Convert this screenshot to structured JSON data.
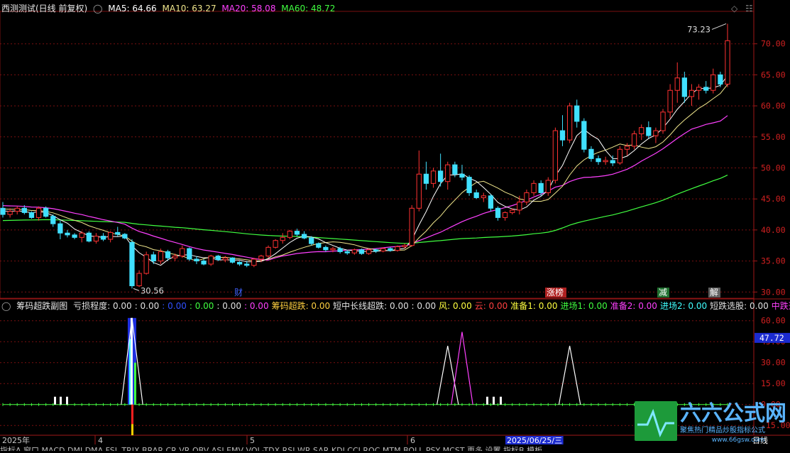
{
  "header": {
    "title": "西测测试(日线 前复权)",
    "ma": [
      {
        "label": "MA5: 64.66",
        "color": "#ffffff"
      },
      {
        "label": "MA10: 63.27",
        "color": "#f0e68c"
      },
      {
        "label": "MA20: 58.08",
        "color": "#ff40ff"
      },
      {
        "label": "MA60: 48.72",
        "color": "#40ff40"
      }
    ]
  },
  "sub_header": {
    "title": "筹码超跌副图",
    "items": [
      {
        "label": "亏损程度: 0.00",
        "color": "#e0e0e0"
      },
      {
        "label": ": 0.00",
        "color": "#e0e0e0"
      },
      {
        "label": ": 0.00",
        "color": "#3050ff"
      },
      {
        "label": ": 0.00",
        "color": "#40ff40"
      },
      {
        "label": ": 0.00",
        "color": "#e0e0e0"
      },
      {
        "label": ": 0.00",
        "color": "#ff40ff"
      },
      {
        "label": "筹码超跌: 0.00",
        "color": "#ffd040"
      },
      {
        "label": "短中长线超跌: 0.00 : 0.00",
        "color": "#e0e0e0"
      },
      {
        "label": "风: 0.00",
        "color": "#ffff40"
      },
      {
        "label": "云: 0.00",
        "color": "#ff4040"
      },
      {
        "label": "准备1: 0.00",
        "color": "#ffff40"
      },
      {
        "label": "进场1: 0.00",
        "color": "#40ff40"
      },
      {
        "label": "准备2: 0.00",
        "color": "#ff40ff"
      },
      {
        "label": "进场2: 0.00",
        "color": "#40ffff"
      },
      {
        "label": "短跌选股: 0.00",
        "color": "#e0e0e0"
      },
      {
        "label": "中跌选股",
        "color": "#ff40ff"
      }
    ]
  },
  "colors": {
    "up": "#ff3232",
    "down": "#40e0ff",
    "ma5": "#ffffff",
    "ma10": "#f0e68c",
    "ma20": "#ff40ff",
    "ma60": "#40ff40",
    "grid": "#7a1010"
  },
  "chart_data": [
    {
      "type": "candlestick",
      "y_ticks": [
        "70.00",
        "65.00",
        "60.00",
        "55.00",
        "50.00",
        "45.00",
        "40.00",
        "35.00",
        "30.00"
      ],
      "ylim": [
        29,
        75
      ],
      "annotations": {
        "high": "73.23",
        "low": "30.56"
      },
      "event_tags": [
        {
          "text": "财",
          "color": "#4060ff",
          "bg": "#000"
        },
        {
          "text": "涨榜",
          "color": "#fff",
          "bg": "#b02020"
        },
        {
          "text": "减",
          "color": "#fff",
          "bg": "#207030"
        },
        {
          "text": "解",
          "color": "#fff",
          "bg": "#606060"
        }
      ],
      "candles": [
        [
          43.5,
          44.5,
          42.0,
          42.5
        ],
        [
          42.5,
          43.5,
          42.0,
          43.0
        ],
        [
          43.0,
          43.8,
          42.5,
          43.5
        ],
        [
          43.5,
          44.0,
          42.5,
          42.8
        ],
        [
          42.8,
          43.0,
          41.8,
          42.0
        ],
        [
          42.0,
          43.8,
          41.5,
          43.5
        ],
        [
          43.5,
          43.8,
          42.0,
          42.2
        ],
        [
          42.2,
          42.5,
          40.5,
          41.0
        ],
        [
          41.0,
          41.5,
          38.5,
          39.5
        ],
        [
          39.5,
          40.0,
          38.8,
          39.2
        ],
        [
          39.2,
          39.5,
          38.5,
          38.8
        ],
        [
          38.8,
          39.8,
          38.0,
          39.5
        ],
        [
          39.5,
          39.8,
          38.0,
          38.2
        ],
        [
          38.2,
          39.5,
          37.8,
          39.0
        ],
        [
          39.0,
          39.5,
          38.2,
          38.5
        ],
        [
          38.5,
          39.8,
          38.0,
          39.6
        ],
        [
          39.6,
          40.5,
          39.0,
          39.3
        ],
        [
          39.3,
          39.5,
          38.5,
          38.7
        ],
        [
          38.0,
          38.5,
          30.56,
          31.0
        ],
        [
          31.0,
          33.5,
          30.8,
          33.0
        ],
        [
          33.0,
          36.5,
          32.8,
          36.0
        ],
        [
          36.0,
          36.5,
          34.5,
          35.0
        ],
        [
          35.0,
          37.0,
          34.5,
          36.5
        ],
        [
          36.5,
          36.8,
          35.0,
          35.5
        ],
        [
          35.5,
          36.2,
          35.0,
          35.8
        ],
        [
          35.8,
          37.5,
          35.5,
          37.0
        ],
        [
          37.0,
          37.2,
          35.0,
          35.3
        ],
        [
          35.3,
          35.8,
          34.5,
          35.0
        ],
        [
          35.0,
          35.3,
          34.3,
          34.5
        ],
        [
          34.5,
          36.0,
          34.2,
          35.8
        ],
        [
          35.8,
          36.0,
          35.0,
          35.2
        ],
        [
          35.2,
          35.8,
          34.8,
          35.5
        ],
        [
          35.5,
          35.6,
          34.6,
          34.8
        ],
        [
          34.8,
          35.0,
          34.2,
          34.5
        ],
        [
          34.5,
          35.0,
          34.0,
          34.3
        ],
        [
          34.3,
          35.5,
          34.0,
          35.3
        ],
        [
          35.3,
          36.0,
          34.8,
          35.8
        ],
        [
          35.8,
          37.5,
          35.5,
          37.2
        ],
        [
          37.2,
          38.5,
          37.0,
          38.3
        ],
        [
          38.3,
          39.5,
          37.8,
          38.8
        ],
        [
          38.8,
          40.0,
          38.5,
          39.8
        ],
        [
          39.8,
          40.2,
          39.0,
          39.3
        ],
        [
          39.3,
          39.8,
          38.5,
          38.7
        ],
        [
          38.7,
          39.0,
          37.5,
          37.8
        ],
        [
          37.8,
          38.0,
          37.0,
          37.2
        ],
        [
          37.2,
          37.5,
          36.5,
          36.8
        ],
        [
          36.8,
          37.3,
          36.4,
          37.0
        ],
        [
          37.0,
          37.3,
          36.2,
          36.5
        ],
        [
          36.5,
          36.8,
          36.0,
          36.3
        ],
        [
          36.3,
          37.0,
          36.0,
          36.8
        ],
        [
          36.8,
          37.0,
          36.0,
          36.2
        ],
        [
          36.2,
          37.0,
          36.0,
          36.8
        ],
        [
          36.8,
          37.0,
          36.3,
          36.6
        ],
        [
          36.6,
          37.2,
          36.4,
          37.0
        ],
        [
          37.0,
          37.2,
          36.5,
          36.7
        ],
        [
          36.7,
          37.5,
          36.5,
          37.3
        ],
        [
          37.3,
          37.8,
          37.0,
          37.5
        ],
        [
          37.5,
          44.0,
          37.3,
          43.5
        ],
        [
          43.5,
          52.8,
          43.0,
          49.0
        ],
        [
          49.0,
          51.0,
          46.5,
          47.5
        ],
        [
          47.5,
          50.0,
          46.8,
          49.5
        ],
        [
          49.5,
          52.3,
          47.0,
          47.8
        ],
        [
          47.8,
          51.0,
          46.5,
          50.5
        ],
        [
          50.5,
          51.0,
          48.5,
          49.0
        ],
        [
          49.0,
          50.5,
          48.0,
          48.5
        ],
        [
          48.5,
          48.8,
          45.5,
          46.0
        ],
        [
          46.0,
          46.5,
          45.0,
          45.2
        ],
        [
          45.2,
          46.0,
          44.5,
          45.5
        ],
        [
          45.5,
          45.8,
          43.0,
          43.5
        ],
        [
          43.5,
          43.8,
          41.5,
          42.0
        ],
        [
          42.0,
          43.0,
          41.5,
          42.8
        ],
        [
          42.8,
          43.5,
          42.5,
          43.2
        ],
        [
          43.2,
          45.5,
          42.5,
          44.5
        ],
        [
          44.5,
          46.5,
          44.0,
          46.0
        ],
        [
          46.0,
          48.0,
          45.5,
          47.5
        ],
        [
          47.5,
          48.0,
          45.5,
          46.0
        ],
        [
          46.0,
          48.5,
          45.5,
          48.0
        ],
        [
          48.0,
          56.5,
          47.5,
          56.0
        ],
        [
          56.0,
          58.5,
          53.5,
          54.5
        ],
        [
          54.5,
          60.5,
          54.0,
          60.0
        ],
        [
          60.0,
          61.0,
          56.5,
          57.5
        ],
        [
          57.5,
          58.0,
          52.5,
          53.0
        ],
        [
          53.0,
          53.5,
          51.0,
          51.5
        ],
        [
          51.5,
          52.0,
          50.5,
          51.0
        ],
        [
          51.0,
          51.8,
          50.5,
          51.2
        ],
        [
          51.2,
          52.0,
          50.3,
          50.8
        ],
        [
          50.8,
          53.5,
          50.5,
          53.0
        ],
        [
          53.0,
          54.0,
          52.0,
          53.5
        ],
        [
          53.5,
          56.0,
          53.0,
          55.5
        ],
        [
          55.5,
          57.0,
          54.5,
          56.5
        ],
        [
          56.5,
          57.5,
          54.8,
          55.2
        ],
        [
          55.2,
          56.5,
          54.0,
          56.0
        ],
        [
          56.0,
          59.5,
          55.5,
          59.0
        ],
        [
          59.0,
          63.5,
          58.0,
          62.5
        ],
        [
          62.5,
          67.0,
          60.5,
          64.5
        ],
        [
          64.5,
          65.5,
          60.5,
          61.5
        ],
        [
          61.5,
          63.5,
          60.0,
          62.5
        ],
        [
          62.5,
          63.5,
          61.0,
          63.0
        ],
        [
          63.0,
          64.0,
          62.0,
          62.5
        ],
        [
          62.5,
          66.0,
          62.0,
          65.0
        ],
        [
          65.0,
          65.5,
          63.0,
          63.5
        ],
        [
          63.5,
          73.23,
          63.0,
          70.5
        ]
      ]
    },
    {
      "type": "indicator",
      "y_ticks": [
        "60.00",
        "45.00",
        "30.00",
        "15.00",
        "0.00",
        "-15.00"
      ],
      "ylim": [
        -22,
        68
      ],
      "current_value": "47.72",
      "spikes": [
        {
          "i": 18,
          "peak": 62,
          "color": "#ffffff"
        },
        {
          "i": 62,
          "peak": 42,
          "color": "#ffffff"
        },
        {
          "i": 64,
          "peak": 52,
          "color": "#ff40ff"
        },
        {
          "i": 79,
          "peak": 42,
          "color": "#ffffff"
        }
      ],
      "ticks_small": [
        7,
        8,
        9,
        66,
        67,
        68
      ]
    }
  ],
  "xaxis": {
    "labels": [
      {
        "text": "2025年",
        "color": "#c8c8c8"
      },
      {
        "text": "4",
        "color": "#c8c8c8"
      },
      {
        "text": "5",
        "color": "#c8c8c8"
      },
      {
        "text": "6",
        "color": "#c8c8c8"
      },
      {
        "text": "2025/06/25/三",
        "color": "#ffffff",
        "bg": "#1b2bd0"
      },
      {
        "text": "日线",
        "color": "#ffffff"
      }
    ]
  },
  "toolbar": "指标A 窗口 MACD DMI DMA FSL TRIX BRAR CR VR OBV ASI EMV VOL-TDX RSI WR SAR KDJ CCI ROC MTM BOLL PSY MCST 更多 设置 指标B 模板",
  "watermark": {
    "logo": "六六公式网",
    "tagline": "聚焦热门精品炒股指标公式",
    "url": "www.66gsw.com"
  }
}
